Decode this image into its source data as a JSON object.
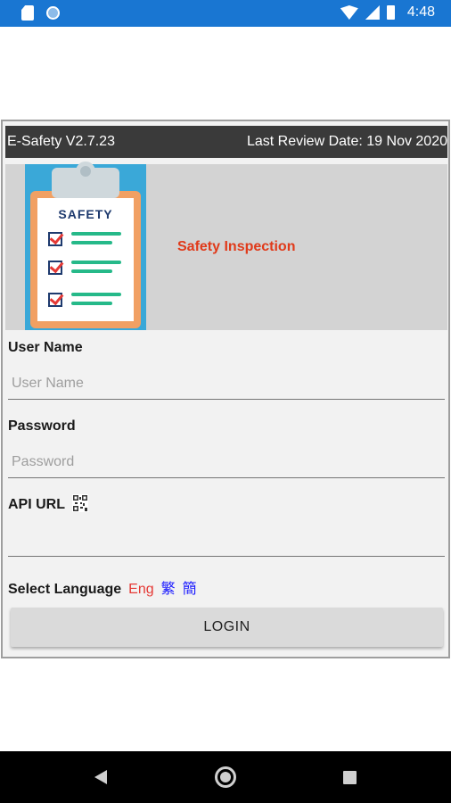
{
  "status_bar": {
    "time": "4:48",
    "background_color": "#1976d2",
    "icons": [
      "sd-card-icon",
      "circle-notification-icon",
      "wifi-icon",
      "signal-icon",
      "battery-icon"
    ]
  },
  "header": {
    "app_version": "E-Safety V2.7.23",
    "review_date": "Last Review Date: 19 Nov 2020"
  },
  "banner": {
    "logo_text": "SAFETY",
    "title": "Safety Inspection",
    "title_color": "#e03a1a"
  },
  "form": {
    "username": {
      "label": "User Name",
      "placeholder": "User Name",
      "value": ""
    },
    "password": {
      "label": "Password",
      "placeholder": "Password",
      "value": ""
    },
    "api_url": {
      "label": "API URL",
      "value": "",
      "icon": "qr-code-icon"
    }
  },
  "language": {
    "label": "Select Language",
    "options": [
      "Eng",
      "繁",
      "簡"
    ],
    "selected": "Eng",
    "selected_color": "#e53935",
    "other_color": "#1a1aff"
  },
  "login_button": {
    "label": "LOGIN"
  },
  "nav_bar": {
    "icons": [
      "back-icon",
      "home-icon",
      "recent-apps-icon"
    ]
  }
}
